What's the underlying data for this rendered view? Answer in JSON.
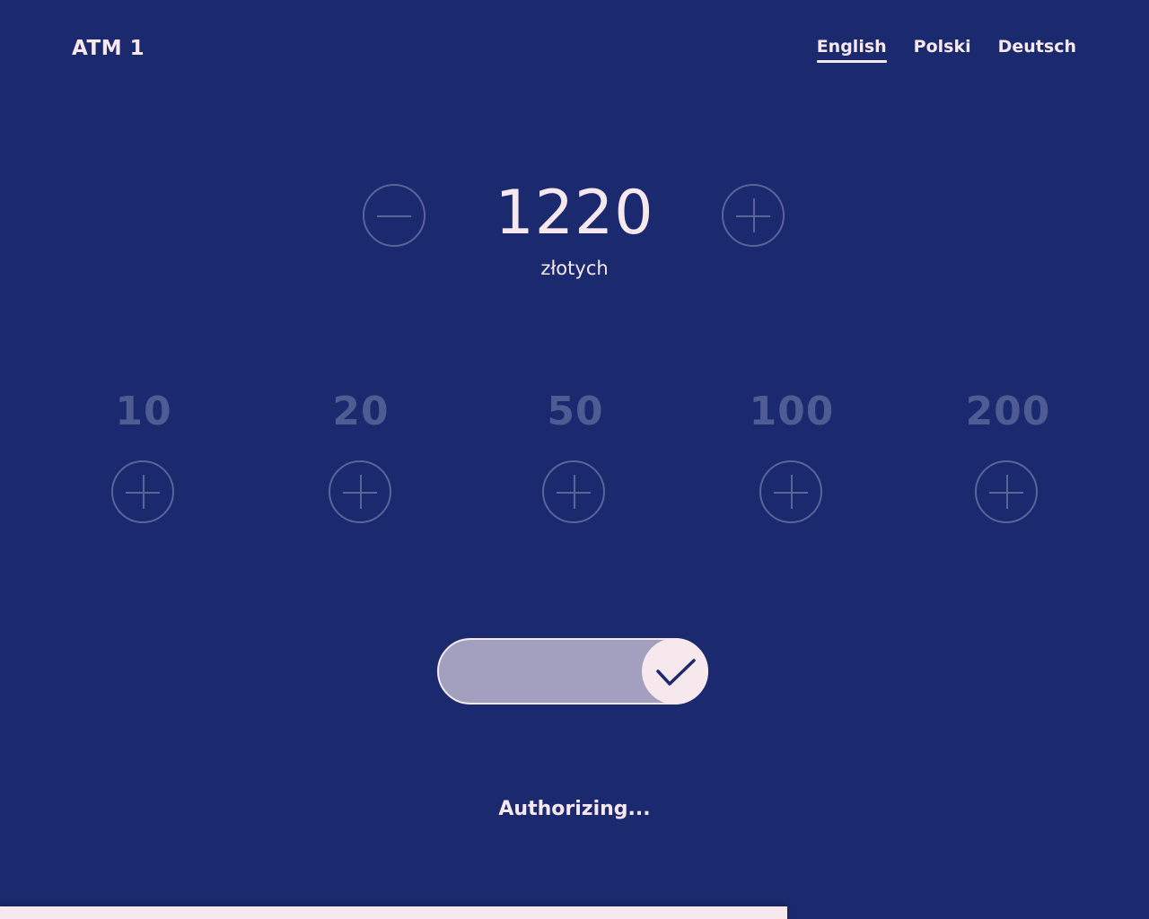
{
  "header": {
    "brand": "ATM 1",
    "languages": [
      {
        "label": "English",
        "active": true
      },
      {
        "label": "Polski",
        "active": false
      },
      {
        "label": "Deutsch",
        "active": false
      }
    ]
  },
  "amount": {
    "value": "1220",
    "currency": "złotych"
  },
  "denominations": [
    "10",
    "20",
    "50",
    "100",
    "200"
  ],
  "confirm": {
    "state": "confirmed",
    "icon": "check-icon"
  },
  "status": {
    "text": "Authorizing..."
  },
  "progress": {
    "fraction": 0.685
  },
  "colors": {
    "background": "#1b2a6f",
    "foreground": "#f6e8ec",
    "muted": "#4f5b93",
    "slider": "#a39fbe"
  }
}
